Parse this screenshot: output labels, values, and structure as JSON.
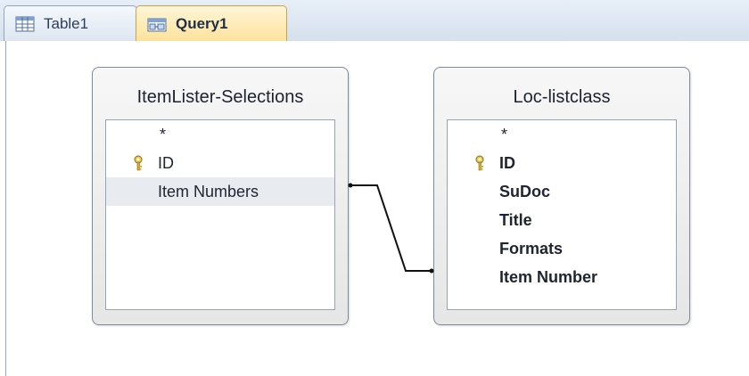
{
  "tabs": [
    {
      "label": "Table1",
      "icon": "table-icon",
      "active": false
    },
    {
      "label": "Query1",
      "icon": "query-icon",
      "active": true
    }
  ],
  "left_table": {
    "title": "ItemLister-Selections",
    "fields": [
      {
        "label": "*",
        "key": false
      },
      {
        "label": "ID",
        "key": true
      },
      {
        "label": "Item Numbers",
        "key": false,
        "selected": true
      }
    ]
  },
  "right_table": {
    "title": "Loc-listclass",
    "fields": [
      {
        "label": "*",
        "key": false
      },
      {
        "label": "ID",
        "key": true
      },
      {
        "label": "SuDoc",
        "key": false
      },
      {
        "label": "Title",
        "key": false
      },
      {
        "label": "Formats",
        "key": false
      },
      {
        "label": "Item Number",
        "key": false
      }
    ]
  },
  "relationship": {
    "from": "Item Numbers",
    "to": "Item Number"
  }
}
